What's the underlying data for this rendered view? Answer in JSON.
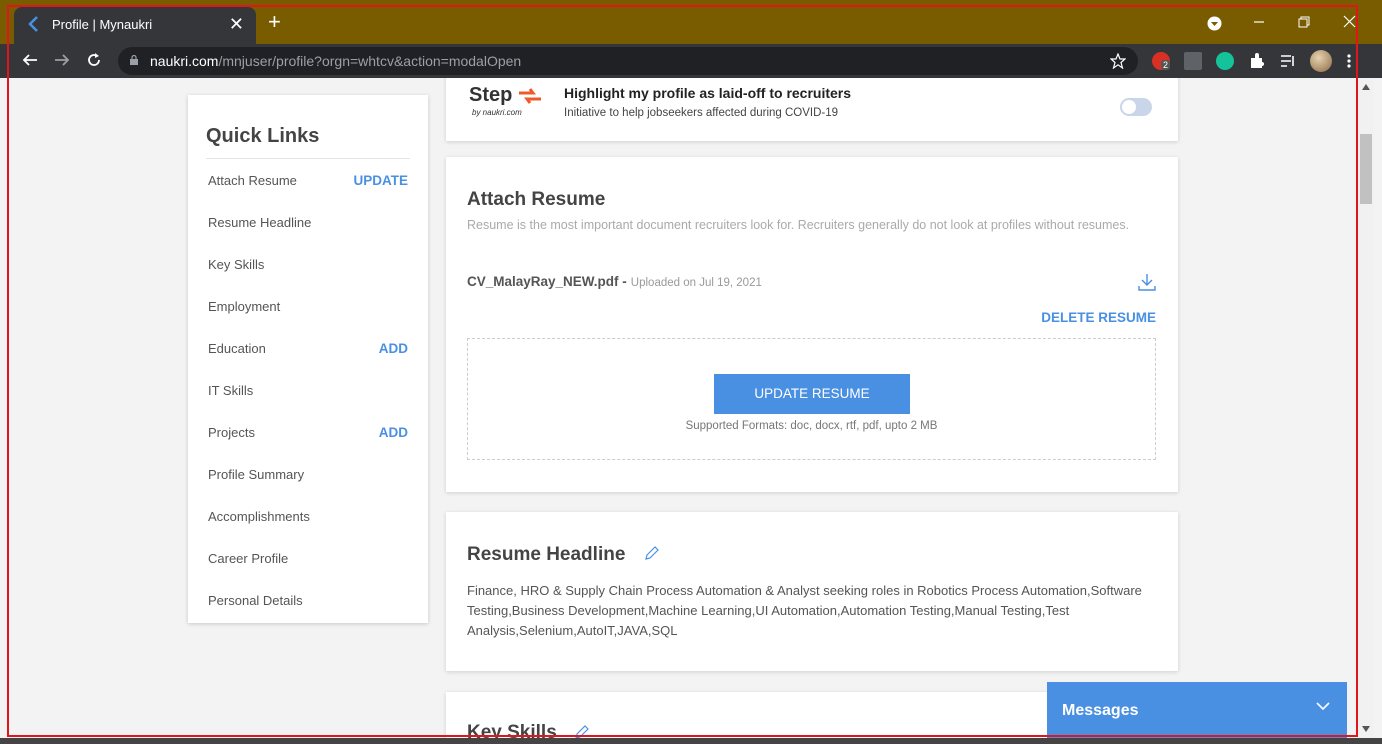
{
  "browser": {
    "tab_title": "Profile | Mynaukri",
    "tab_close": "✕",
    "new_tab": "+",
    "url_host": "naukri.com",
    "url_path": "/mnjuser/profile?orgn=whtcv&action=modalOpen",
    "extension_badge": "2",
    "icons": [
      "back-icon",
      "forward-icon",
      "reload-icon",
      "lock-icon",
      "star-icon",
      "extensions-icon",
      "reading-list-icon",
      "avatar"
    ]
  },
  "quick_links": {
    "title": "Quick Links",
    "items": [
      {
        "label": "Attach Resume",
        "action": "UPDATE"
      },
      {
        "label": "Resume Headline",
        "action": ""
      },
      {
        "label": "Key Skills",
        "action": ""
      },
      {
        "label": "Employment",
        "action": ""
      },
      {
        "label": "Education",
        "action": "ADD"
      },
      {
        "label": "IT Skills",
        "action": ""
      },
      {
        "label": "Projects",
        "action": "ADD"
      },
      {
        "label": "Profile Summary",
        "action": ""
      },
      {
        "label": "Accomplishments",
        "action": ""
      },
      {
        "label": "Career Profile",
        "action": ""
      },
      {
        "label": "Personal Details",
        "action": ""
      }
    ]
  },
  "laid_off": {
    "logo_text": "Step",
    "logo_sub": "by naukri.com",
    "title": "Highlight my profile as laid-off to recruiters",
    "subtitle": "Initiative to help jobseekers affected during COVID-19",
    "toggle_on": false
  },
  "attach_resume": {
    "heading": "Attach Resume",
    "description": "Resume is the most important document recruiters look for. Recruiters generally do not look at profiles without resumes.",
    "file_name": "CV_MalayRay_NEW.pdf -",
    "uploaded": "Uploaded on Jul 19, 2021",
    "delete_label": "DELETE RESUME",
    "update_label": "UPDATE RESUME",
    "formats": "Supported Formats: doc, docx, rtf, pdf, upto 2 MB"
  },
  "resume_headline": {
    "heading": "Resume Headline",
    "text": "Finance, HRO & Supply Chain Process Automation & Analyst seeking roles in Robotics Process Automation,Software Testing,Business Development,Machine Learning,UI Automation,Automation Testing,Manual Testing,Test Analysis,Selenium,AutoIT,JAVA,SQL"
  },
  "key_skills": {
    "heading": "Key Skills"
  },
  "messages": {
    "label": "Messages"
  },
  "colors": {
    "accent": "#4a90e2",
    "titlebar": "#7a5c00",
    "toolbar": "#35363a",
    "highlight_frame": "#e0161c"
  }
}
